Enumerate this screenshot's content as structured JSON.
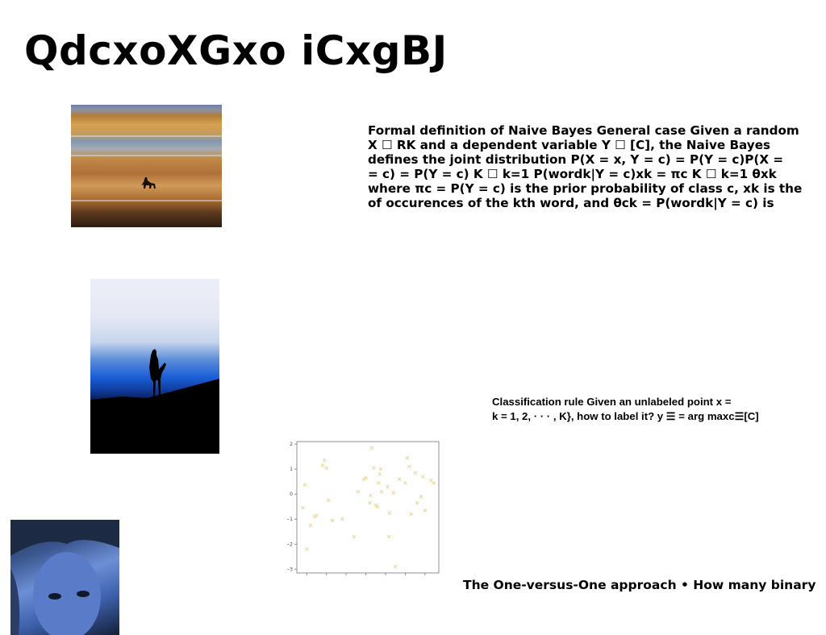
{
  "title": "QdcxoXGxo iCxgBJ",
  "naive_bayes": {
    "lines": [
      "Formal definition of Naive Bayes General case Given a random",
      "X ☐ RK and a dependent variable Y ☐ [C], the Naive Bayes",
      "defines the joint distribution P(X = x, Y = c) = P(Y = c)P(X =",
      "= c) = P(Y = c) K ☐ k=1 P(wordk|Y = c)xk = πc K ☐ k=1 θxk",
      "where πc = P(Y = c) is the prior probability of class c, xk is the",
      "of occurences of the kth word, and θck = P(wordk|Y = c) is"
    ]
  },
  "classification_rule": {
    "lines": [
      "Classification rule Given an unlabeled point x =",
      "k = 1, 2, · · · , K}, how to label it? y ☰ = arg maxc☰[C]"
    ]
  },
  "one_vs_one": "The One-versus-One approach • How many binary",
  "chart_data": {
    "type": "scatter",
    "xlim": [
      -1.75,
      1.85
    ],
    "ylim": [
      -3.15,
      2.1
    ],
    "xticks": [
      "−1.5",
      "−1.0",
      "−0.5",
      "0.0",
      "0.5",
      "1.0",
      "1.5"
    ],
    "yticks": [
      "2",
      "1",
      "0",
      "−1",
      "−2",
      "−3"
    ],
    "marker_color": "#e8d9a0",
    "points": [
      [
        -1.55,
        0.37
      ],
      [
        -1.6,
        -0.55
      ],
      [
        -1.5,
        -2.2
      ],
      [
        -1.4,
        -1.25
      ],
      [
        -1.3,
        -0.9
      ],
      [
        -1.25,
        -0.85
      ],
      [
        -1.1,
        1.15
      ],
      [
        -1.05,
        1.35
      ],
      [
        -1.0,
        1.05
      ],
      [
        -0.95,
        -0.25
      ],
      [
        -0.85,
        -1.05
      ],
      [
        -0.6,
        -1.0
      ],
      [
        -0.3,
        -1.7
      ],
      [
        -0.2,
        0.1
      ],
      [
        -0.05,
        0.6
      ],
      [
        0.0,
        0.65
      ],
      [
        0.1,
        -0.35
      ],
      [
        0.15,
        1.85
      ],
      [
        0.12,
        -0.05
      ],
      [
        0.2,
        1.05
      ],
      [
        0.25,
        -0.45
      ],
      [
        0.3,
        -0.5
      ],
      [
        0.32,
        0.45
      ],
      [
        0.35,
        0.8
      ],
      [
        0.38,
        1.0
      ],
      [
        0.4,
        0.1
      ],
      [
        0.55,
        0.3
      ],
      [
        0.6,
        -0.75
      ],
      [
        0.58,
        -1.7
      ],
      [
        0.7,
        0.05
      ],
      [
        0.75,
        -2.9
      ],
      [
        0.85,
        0.6
      ],
      [
        1.05,
        1.45
      ],
      [
        1.1,
        1.1
      ],
      [
        1.15,
        -0.8
      ],
      [
        1.25,
        0.85
      ],
      [
        1.3,
        -0.35
      ],
      [
        1.4,
        -0.1
      ],
      [
        1.45,
        0.7
      ],
      [
        1.5,
        -0.65
      ],
      [
        1.65,
        0.55
      ],
      [
        1.72,
        0.45
      ],
      [
        1.0,
        0.45
      ]
    ]
  }
}
